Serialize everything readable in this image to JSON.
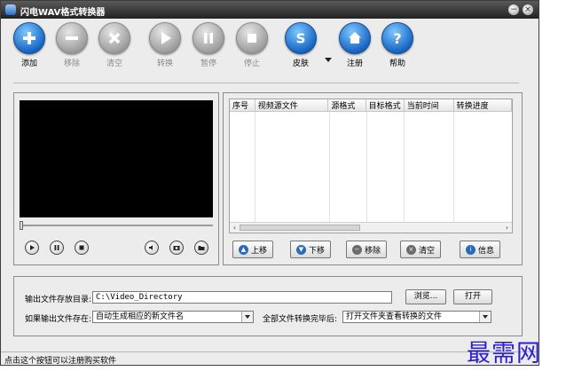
{
  "window": {
    "title": "闪电WAV格式转换器",
    "minimize": "−",
    "close": "×"
  },
  "toolbar": [
    {
      "label": "添加",
      "icon": "plus-icon",
      "enabled": true
    },
    {
      "label": "移除",
      "icon": "minus-icon",
      "enabled": false
    },
    {
      "label": "清空",
      "icon": "clear-x-icon",
      "enabled": false
    },
    {
      "label": "转换",
      "icon": "play-icon",
      "enabled": false
    },
    {
      "label": "暂停",
      "icon": "pause-icon",
      "enabled": false
    },
    {
      "label": "停止",
      "icon": "stop-icon",
      "enabled": false
    },
    {
      "label": "皮肤",
      "icon": "skin-s-icon",
      "enabled": true
    },
    {
      "label": "注册",
      "icon": "home-icon",
      "enabled": true
    },
    {
      "label": "帮助",
      "icon": "question-icon",
      "enabled": true
    }
  ],
  "player": {
    "progress": 0,
    "controls": [
      "play-icon",
      "pause-icon",
      "stop-icon",
      "volume-icon",
      "screenshot-icon",
      "folder-icon"
    ]
  },
  "file_list": {
    "columns": [
      "序号",
      "视频源文件",
      "源格式",
      "目标格式",
      "当前时间",
      "转换进度"
    ],
    "rows": [],
    "scroll_left": "‹",
    "scroll_right": "›"
  },
  "list_buttons": [
    {
      "label": "上移",
      "icon": "up-arrow-icon",
      "color": "#2a6ab8"
    },
    {
      "label": "下移",
      "icon": "down-arrow-icon",
      "color": "#2a6ab8"
    },
    {
      "label": "移除",
      "icon": "remove-icon",
      "color": "#6b6b6b"
    },
    {
      "label": "清空",
      "icon": "clear-icon",
      "color": "#6b6b6b"
    },
    {
      "label": "信息",
      "icon": "info-icon",
      "color": "#2a6ab8"
    }
  ],
  "output": {
    "dir_label": "输出文件存放目录:",
    "dir_value": "C:\\Video_Directory",
    "browse_label": "浏览...",
    "open_label": "打开",
    "exists_label": "如果输出文件存在:",
    "exists_value": "自动生成相应的新文件名",
    "after_label": "全部文件转换完毕后:",
    "after_value": "打开文件夹查看转换的文件"
  },
  "status_text": "点击这个按钮可以注册购买软件",
  "watermark": "最需网",
  "colors": {
    "accent": "#1766c5",
    "disabled": "#9e9e9e",
    "watermark": "#2b1fd0"
  }
}
